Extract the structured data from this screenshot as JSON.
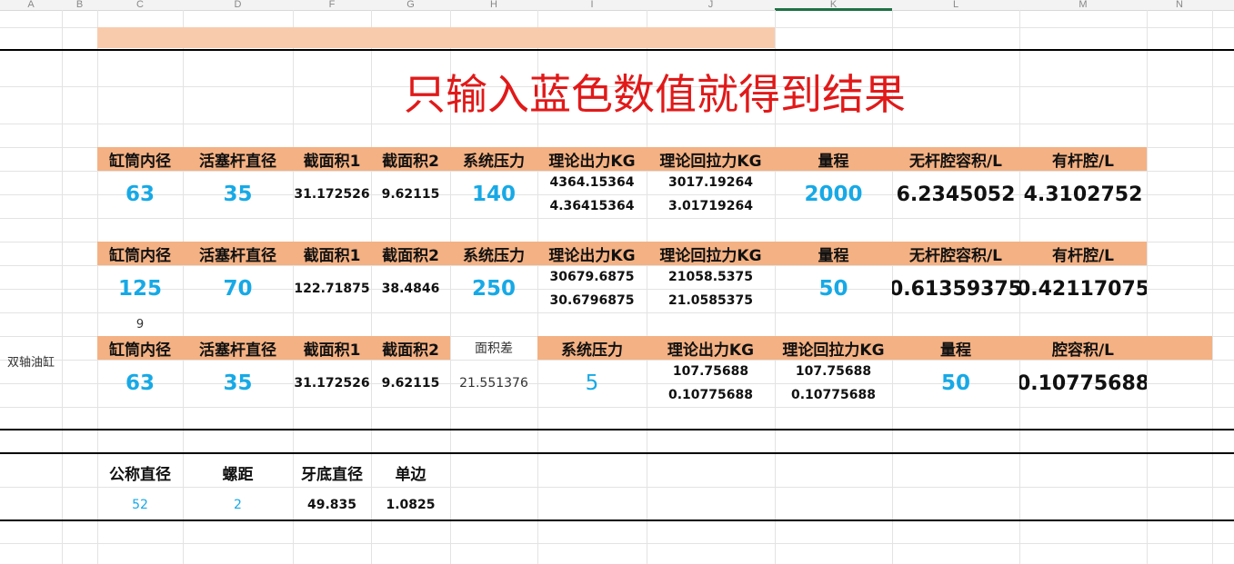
{
  "columns": [
    "A",
    "B",
    "C",
    "D",
    "F",
    "G",
    "H",
    "I",
    "J",
    "K",
    "L",
    "M",
    "N"
  ],
  "title": "只输入蓝色数值就得到结果",
  "colors": {
    "header_fill": "#f4b183",
    "top_band": "#f8cbad",
    "title": "#e11919",
    "input_blue": "#17a9e6",
    "selected_col": "#1e7145"
  },
  "row_label": "双轴油缸",
  "table1": {
    "headers": [
      "缸筒内径",
      "活塞杆直径",
      "截面积1",
      "截面积2",
      "系统压力",
      "理论出力KG",
      "理论回拉力KG",
      "量程",
      "无杆腔容积/L",
      "有杆腔/L"
    ],
    "bore": "63",
    "rod": "35",
    "area1": "31.172526",
    "area2": "9.62115",
    "pressure": "140",
    "force1": "4364.15364",
    "force2": "4.36415364",
    "pull1": "3017.19264",
    "pull2": "3.01719264",
    "stroke": "2000",
    "vol_rodless": "6.2345052",
    "vol_rod": "4.3102752"
  },
  "table2": {
    "headers": [
      "缸筒内径",
      "活塞杆直径",
      "截面积1",
      "截面积2",
      "系统压力",
      "理论出力KG",
      "理论回拉力KG",
      "量程",
      "无杆腔容积/L",
      "有杆腔/L"
    ],
    "bore": "125",
    "rod": "70",
    "area1": "122.71875",
    "area2": "38.4846",
    "pressure": "250",
    "force1": "30679.6875",
    "force2": "30.6796875",
    "pull1": "21058.5375",
    "pull2": "21.0585375",
    "stroke": "50",
    "vol_rodless": "0.61359375",
    "vol_rod": "0.42117075"
  },
  "note_9": "9",
  "table3": {
    "headers": [
      "缸筒内径",
      "活塞杆直径",
      "截面积1",
      "截面积2",
      "面积差",
      "系统压力",
      "理论出力KG",
      "理论回拉力KG",
      "量程",
      "腔容积/L"
    ],
    "bore": "63",
    "rod": "35",
    "area1": "31.172526",
    "area2": "9.62115",
    "area_diff": "21.551376",
    "pressure": "5",
    "force1": "107.75688",
    "force2": "0.10775688",
    "pull1": "107.75688",
    "pull2": "0.10775688",
    "stroke": "50",
    "vol": "0.10775688"
  },
  "thread": {
    "headers": [
      "公称直径",
      "螺距",
      "牙底直径",
      "单边"
    ],
    "nominal": "52",
    "pitch": "2",
    "root": "49.835",
    "single": "1.0825"
  }
}
